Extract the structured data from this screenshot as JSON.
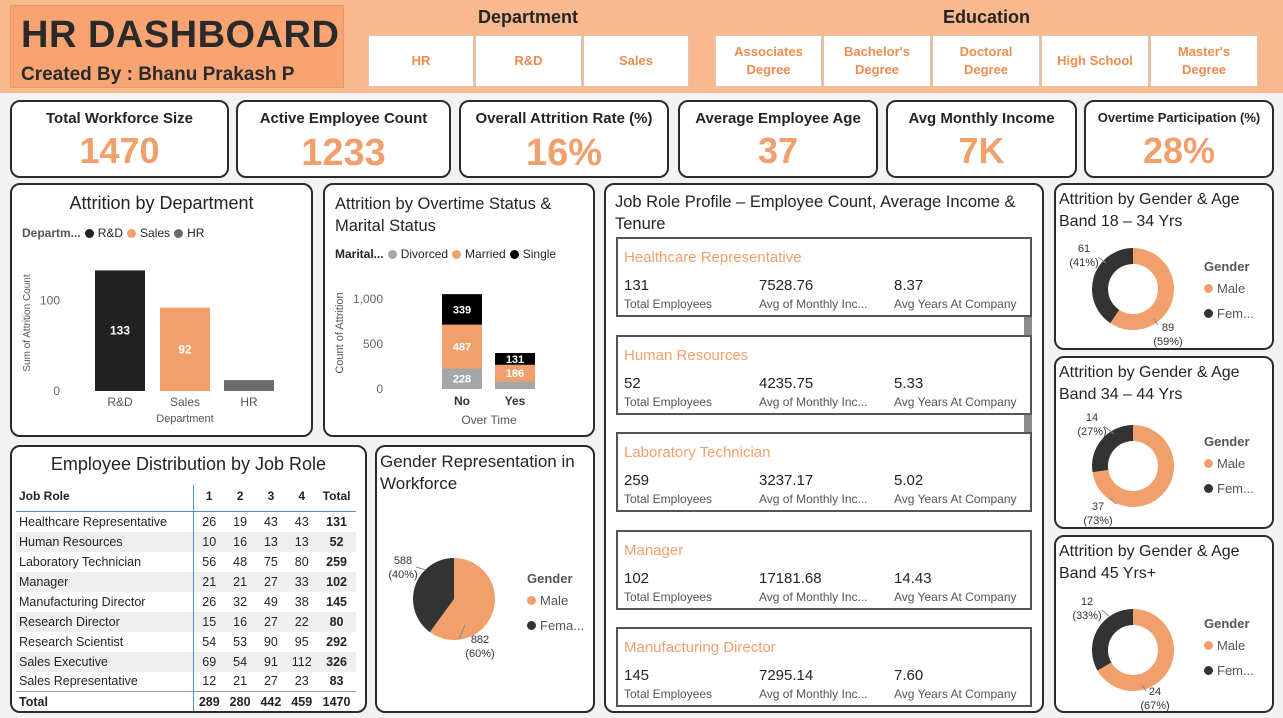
{
  "header": {
    "title": "HR DASHBOARD",
    "subtitle": "Created By : Bhanu Prakash P",
    "department_label": "Department",
    "department_options": [
      "HR",
      "R&D",
      "Sales"
    ],
    "education_label": "Education",
    "education_options": [
      "Associates Degree",
      "Bachelor's Degree",
      "Doctoral Degree",
      "High School",
      "Master's Degree"
    ]
  },
  "kpis": [
    {
      "title": "Total Workforce Size",
      "value": "1470"
    },
    {
      "title": "Active Employee Count",
      "value": "1233"
    },
    {
      "title": "Overall Attrition Rate (%)",
      "value": "16%"
    },
    {
      "title": "Average Employee Age",
      "value": "37"
    },
    {
      "title": "Avg Monthly Income",
      "value": "7K"
    },
    {
      "title": "Overtime Participation (%)",
      "value": "28%"
    }
  ],
  "colors": {
    "accent": "#f2a06b",
    "dark": "#222222",
    "gray": "#7f7f7f",
    "header_bg": "#f9b98f"
  },
  "chart_data": [
    {
      "id": "attrition_by_department",
      "type": "bar",
      "title": "Attrition by Department",
      "legend_title": "Departm...",
      "legend": [
        "R&D",
        "Sales",
        "HR"
      ],
      "categories": [
        "R&D",
        "Sales",
        "HR"
      ],
      "values": [
        133,
        92,
        12
      ],
      "data_labels": [
        "133",
        "92",
        ""
      ],
      "colors": [
        "#222222",
        "#f2a06b",
        "#6b6b6b"
      ],
      "xlabel": "Department",
      "ylabel": "Sum of Attrition Count",
      "yticks": [
        "0",
        "100"
      ],
      "ylim": [
        0,
        150
      ]
    },
    {
      "id": "attrition_by_overtime_marital",
      "type": "bar",
      "stacked": true,
      "title": "Attrition by Overtime Status & Marital Status",
      "legend_title": "Marital...",
      "categories": [
        "No",
        "Yes"
      ],
      "series": [
        {
          "name": "Divorced",
          "values": [
            228,
            83
          ],
          "labels": [
            "228",
            ""
          ],
          "color": "#a6a6a6"
        },
        {
          "name": "Married",
          "values": [
            487,
            186
          ],
          "labels": [
            "487",
            "186"
          ],
          "color": "#f2a06b"
        },
        {
          "name": "Single",
          "values": [
            339,
            131
          ],
          "labels": [
            "339",
            "131"
          ],
          "color": "#000000"
        }
      ],
      "xlabel": "Over Time",
      "ylabel": "Count of Attrition",
      "yticks": [
        "0",
        "500",
        "1,000"
      ],
      "ylim": [
        0,
        1200
      ]
    },
    {
      "id": "employee_distribution_by_job_role",
      "type": "table",
      "title": "Employee Distribution by Job Role",
      "columns": [
        "Job Role",
        "1",
        "2",
        "3",
        "4",
        "Total"
      ],
      "rows": [
        [
          "Healthcare Representative",
          "26",
          "19",
          "43",
          "43",
          "131"
        ],
        [
          "Human Resources",
          "10",
          "16",
          "13",
          "13",
          "52"
        ],
        [
          "Laboratory Technician",
          "56",
          "48",
          "75",
          "80",
          "259"
        ],
        [
          "Manager",
          "21",
          "21",
          "27",
          "33",
          "102"
        ],
        [
          "Manufacturing Director",
          "26",
          "32",
          "49",
          "38",
          "145"
        ],
        [
          "Research Director",
          "15",
          "16",
          "27",
          "22",
          "80"
        ],
        [
          "Research Scientist",
          "54",
          "53",
          "90",
          "95",
          "292"
        ],
        [
          "Sales Executive",
          "69",
          "54",
          "91",
          "112",
          "326"
        ],
        [
          "Sales Representative",
          "12",
          "21",
          "27",
          "23",
          "83"
        ]
      ],
      "total": [
        "Total",
        "289",
        "280",
        "442",
        "459",
        "1470"
      ]
    },
    {
      "id": "gender_representation",
      "type": "pie",
      "title": "Gender Representation in Workforce",
      "legend_title": "Gender",
      "legend": [
        "Male",
        "Fema..."
      ],
      "slices": [
        {
          "name": "Male",
          "value": 882,
          "pct": "(60%)",
          "color": "#f2a06b"
        },
        {
          "name": "Female",
          "value": 588,
          "pct": "(40%)",
          "color": "#333333"
        }
      ]
    },
    {
      "id": "job_role_profile",
      "type": "table",
      "title": "Job Role Profile – Employee Count, Average Income & Tenure",
      "field_labels": [
        "Total Employees",
        "Avg of Monthly Inc...",
        "Avg Years At Company"
      ],
      "rows": [
        {
          "role": "Healthcare Representative",
          "employees": "131",
          "income": "7528.76",
          "tenure": "8.37"
        },
        {
          "role": "Human Resources",
          "employees": "52",
          "income": "4235.75",
          "tenure": "5.33"
        },
        {
          "role": "Laboratory Technician",
          "employees": "259",
          "income": "3237.17",
          "tenure": "5.02"
        },
        {
          "role": "Manager",
          "employees": "102",
          "income": "17181.68",
          "tenure": "14.43"
        },
        {
          "role": "Manufacturing Director",
          "employees": "145",
          "income": "7295.14",
          "tenure": "7.60"
        }
      ]
    },
    {
      "id": "attrition_gender_18_34",
      "type": "pie",
      "donut": true,
      "title": "Attrition by Gender & Age Band 18 – 34 Yrs",
      "legend_title": "Gender",
      "legend": [
        "Male",
        "Fem..."
      ],
      "slices": [
        {
          "name": "Male",
          "value": 89,
          "pct": "(59%)",
          "color": "#f2a06b"
        },
        {
          "name": "Female",
          "value": 61,
          "pct": "(41%)",
          "color": "#333333"
        }
      ]
    },
    {
      "id": "attrition_gender_34_44",
      "type": "pie",
      "donut": true,
      "title": "Attrition by Gender & Age Band 34 – 44 Yrs",
      "legend_title": "Gender",
      "legend": [
        "Male",
        "Fem..."
      ],
      "slices": [
        {
          "name": "Male",
          "value": 37,
          "pct": "(73%)",
          "color": "#f2a06b"
        },
        {
          "name": "Female",
          "value": 14,
          "pct": "(27%)",
          "color": "#333333"
        }
      ]
    },
    {
      "id": "attrition_gender_45plus",
      "type": "pie",
      "donut": true,
      "title": "Attrition by Gender & Age Band 45 Yrs+",
      "legend_title": "Gender",
      "legend": [
        "Male",
        "Fem..."
      ],
      "slices": [
        {
          "name": "Male",
          "value": 24,
          "pct": "(67%)",
          "color": "#f2a06b"
        },
        {
          "name": "Female",
          "value": 12,
          "pct": "(33%)",
          "color": "#333333"
        }
      ]
    }
  ]
}
